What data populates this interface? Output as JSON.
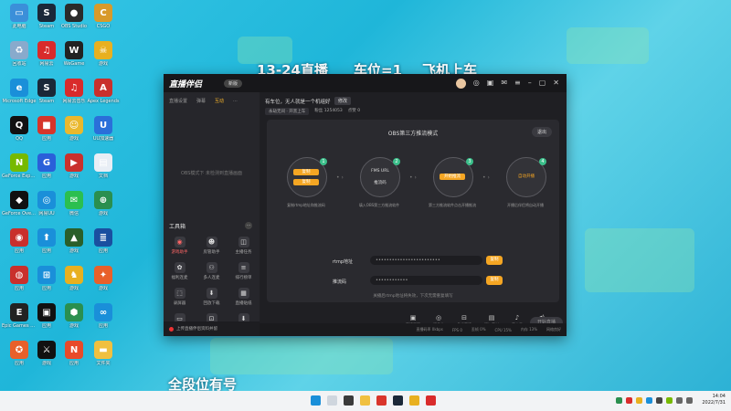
{
  "overlay": {
    "top_line_1": "13-24直播",
    "top_line_2": "车位=1",
    "top_line_3": "飞机上车",
    "bottom_line": "全段位有号"
  },
  "desktop_icons": [
    {
      "label": "此电脑",
      "color": "#3b8fd9",
      "glyph": "▭"
    },
    {
      "label": "Steam",
      "color": "#1b2838",
      "glyph": "S"
    },
    {
      "label": "OBS Studio",
      "color": "#2a2a2a",
      "glyph": "●"
    },
    {
      "label": "CSGO",
      "color": "#d89a2a",
      "glyph": "C"
    },
    {
      "label": "回收站",
      "color": "#88aacc",
      "glyph": "♻"
    },
    {
      "label": "网易云",
      "color": "#d92b2b",
      "glyph": "♫"
    },
    {
      "label": "WeGame",
      "color": "#222",
      "glyph": "W"
    },
    {
      "label": "游戏",
      "color": "#e8b020",
      "glyph": "☠"
    },
    {
      "label": "Microsoft Edge",
      "color": "#1a8fd9",
      "glyph": "e"
    },
    {
      "label": "Steam",
      "color": "#1b2838",
      "glyph": "S"
    },
    {
      "label": "网易云音乐",
      "color": "#d92b2b",
      "glyph": "♫"
    },
    {
      "label": "Apex Legends",
      "color": "#c9302c",
      "glyph": "A"
    },
    {
      "label": "QQ",
      "color": "#111",
      "glyph": "Q"
    },
    {
      "label": "应用",
      "color": "#d6352b",
      "glyph": "■"
    },
    {
      "label": "游戏",
      "color": "#eab82e",
      "glyph": "☺"
    },
    {
      "label": "UU加速器",
      "color": "#2a6fd9",
      "glyph": "U"
    },
    {
      "label": "GeForce Experience",
      "color": "#76b900",
      "glyph": "N"
    },
    {
      "label": "应用",
      "color": "#2a5fd9",
      "glyph": "G"
    },
    {
      "label": "游戏",
      "color": "#c9302c",
      "glyph": "▶"
    },
    {
      "label": "文档",
      "color": "#e8eef5",
      "glyph": "▤"
    },
    {
      "label": "GeForce Overlay",
      "color": "#111",
      "glyph": "◆"
    },
    {
      "label": "网易UU",
      "color": "#1a8fd9",
      "glyph": "◎"
    },
    {
      "label": "微信",
      "color": "#2bbf4f",
      "glyph": "✉"
    },
    {
      "label": "游戏",
      "color": "#2a8f4f",
      "glyph": "⊕"
    },
    {
      "label": "应用",
      "color": "#c9302c",
      "glyph": "◉"
    },
    {
      "label": "应用",
      "color": "#1a8fd9",
      "glyph": "⬆"
    },
    {
      "label": "游戏",
      "color": "#2a5f2a",
      "glyph": "▲"
    },
    {
      "label": "应用",
      "color": "#1a4fa0",
      "glyph": "≣"
    },
    {
      "label": "应用",
      "color": "#c9302c",
      "glyph": "◍"
    },
    {
      "label": "应用",
      "color": "#1a8fd9",
      "glyph": "⊞"
    },
    {
      "label": "游戏",
      "color": "#e8b020",
      "glyph": "♞"
    },
    {
      "label": "游戏",
      "color": "#e8602a",
      "glyph": "✦"
    },
    {
      "label": "Epic Games Launcher",
      "color": "#222",
      "glyph": "E"
    },
    {
      "label": "应用",
      "color": "#111",
      "glyph": "▣"
    },
    {
      "label": "游戏",
      "color": "#2a8f4f",
      "glyph": "⬢"
    },
    {
      "label": "应用",
      "color": "#1a8fd9",
      "glyph": "∞"
    },
    {
      "label": "应用",
      "color": "#e8602a",
      "glyph": "✪"
    },
    {
      "label": "游戏",
      "color": "#111",
      "glyph": "⚔"
    },
    {
      "label": "应用",
      "color": "#e84a2a",
      "glyph": "N"
    },
    {
      "label": "文件夹",
      "color": "#f0c040",
      "glyph": "▬"
    }
  ],
  "app": {
    "logo": "直播伴侣",
    "version": "新版",
    "left_tabs": [
      "直播设置",
      "弹幕",
      "互动",
      "..."
    ],
    "left_empty_text": "OBS模式下 未检测到直播画面",
    "tools_title": "工具箱",
    "tools_more": "···",
    "tools": [
      {
        "label": "游戏助手",
        "glyph": "◉",
        "hot": true
      },
      {
        "label": "房管助手",
        "glyph": "☻",
        "hot": false
      },
      {
        "label": "主播任务",
        "glyph": "◫",
        "hot": false
      },
      {
        "label": "福利连麦",
        "glyph": "✿",
        "hot": false
      },
      {
        "label": "多人连麦",
        "glyph": "⚇",
        "hot": false
      },
      {
        "label": "排行榜单",
        "glyph": "≡",
        "hot": false
      },
      {
        "label": "录屏器",
        "glyph": "⬚",
        "hot": false
      },
      {
        "label": "回放下载",
        "glyph": "⬇",
        "hot": false
      },
      {
        "label": "直播贴纸",
        "glyph": "▦",
        "hot": false
      },
      {
        "label": "更多",
        "glyph": "▭",
        "hot": false
      },
      {
        "label": "活动",
        "glyph": "⊡",
        "hot": false
      },
      {
        "label": "下载",
        "glyph": "⬇",
        "hot": false
      }
    ],
    "left_bottom": "上传直播伴侣资料并留",
    "room_title": "有车位，无人就是一个机组好",
    "room_badge": "修改",
    "room_meta": [
      "永劫无间 · 开黑上车",
      "粉丝 1254053",
      "点赞 0"
    ],
    "obs_title": "OBS第三方推流模式",
    "exit_label": "退出",
    "steps": [
      {
        "num": "1",
        "desc": "复制rtmp地址和推流码"
      },
      {
        "num": "2",
        "top": "FMS URL",
        "bottom": "推流码",
        "desc": "填入OBS第三方推流软件"
      },
      {
        "num": "3",
        "mini": "开始推流",
        "desc": "第三方推流软件点击开播推流"
      },
      {
        "num": "4",
        "center": "自动开播",
        "desc": "开播后伴侣将自动开播"
      }
    ],
    "rtmp_label": "rtmp地址",
    "rtmp_value": "••••••••••••••••••••••••",
    "key_label": "推流码",
    "key_value": "••••••••••••",
    "copy_label": "复制",
    "hint": "关播后rtmp地址将失效，下次无需重复填写",
    "bottom_tools": [
      {
        "label": "直播画面",
        "glyph": "▣"
      },
      {
        "label": "摄像头",
        "glyph": "◎"
      },
      {
        "label": "多机直播",
        "glyph": "⊟"
      },
      {
        "label": "添加素材",
        "glyph": "▤"
      },
      {
        "label": "麦克风",
        "glyph": "♪"
      },
      {
        "label": "扬声器",
        "glyph": "◀)"
      }
    ],
    "live_button": "开始直播",
    "status": [
      "直播码率 0kbps",
      "FPS 0",
      "丢帧 0%",
      "CPU 15%",
      "内存 13%",
      "网络良好"
    ]
  },
  "taskbar": {
    "time": "14:04",
    "date": "2022/7/31"
  }
}
